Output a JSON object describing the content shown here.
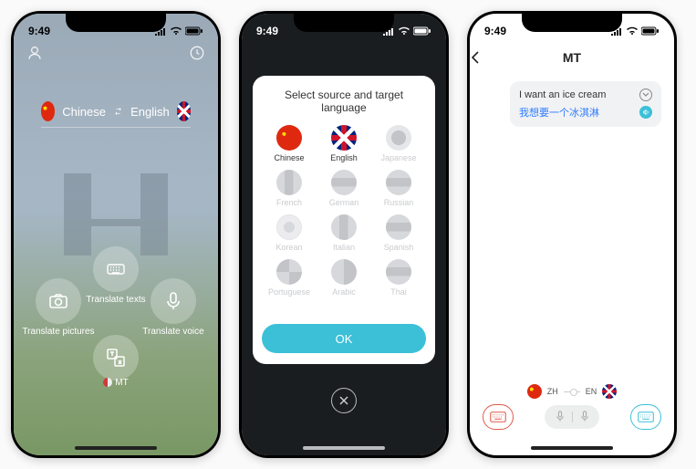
{
  "status": {
    "time": "9:49",
    "carrier_dots": 4
  },
  "screen1": {
    "source_lang": "Chinese",
    "target_lang": "English",
    "actions": {
      "texts": "Translate texts",
      "pictures": "Translate pictures",
      "voice": "Translate voice"
    },
    "brand": "MT"
  },
  "screen2": {
    "title": "Select source and target language",
    "languages": [
      {
        "label": "Chinese",
        "enabled": true,
        "flag": "cn"
      },
      {
        "label": "English",
        "enabled": true,
        "flag": "uk"
      },
      {
        "label": "Japanese",
        "enabled": false,
        "flag": "dot"
      },
      {
        "label": "French",
        "enabled": false,
        "flag": "tri-v"
      },
      {
        "label": "German",
        "enabled": false,
        "flag": "tri-h"
      },
      {
        "label": "Russian",
        "enabled": false,
        "flag": "tri-h"
      },
      {
        "label": "Korean",
        "enabled": false,
        "flag": "kr"
      },
      {
        "label": "Italian",
        "enabled": false,
        "flag": "tri-v"
      },
      {
        "label": "Spanish",
        "enabled": false,
        "flag": "tri-h"
      },
      {
        "label": "Portuguese",
        "enabled": false,
        "flag": "quad"
      },
      {
        "label": "Arabic",
        "enabled": false,
        "flag": "split-v"
      },
      {
        "label": "Thai",
        "enabled": false,
        "flag": "tri-h"
      }
    ],
    "ok": "OK"
  },
  "screen3": {
    "title": "MT",
    "message": {
      "source": "I want an ice cream",
      "target": "我想要一个冰淇淋"
    },
    "bottom": {
      "src_code": "ZH",
      "tgt_code": "EN"
    }
  }
}
